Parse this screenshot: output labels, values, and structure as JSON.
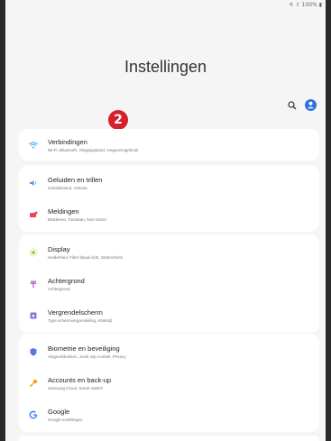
{
  "status": {
    "text": "⚟ ⇧ 100% ▮"
  },
  "header": {
    "title": "Instellingen"
  },
  "annotation": {
    "badge": "2"
  },
  "sections": [
    {
      "items": [
        {
          "label": "Verbindingen",
          "sub": "Wi-Fi, Bluetooth, Vliegtuigstand, Gegevensgebruik",
          "icon": "wifi-icon",
          "color": "#3aa0e8"
        }
      ]
    },
    {
      "items": [
        {
          "label": "Geluiden en trillen",
          "sub": "Geluidsstand, Volume",
          "icon": "volume-icon",
          "color": "#5b8fe8"
        },
        {
          "label": "Meldingen",
          "sub": "Blokkeren, Toestaan, Niet storen",
          "icon": "notification-icon",
          "color": "#e8455a"
        }
      ]
    },
    {
      "items": [
        {
          "label": "Display",
          "sub": "Helderheid, Filter blauw licht, Startscherm",
          "icon": "sun-icon",
          "color": "#9bd23a"
        },
        {
          "label": "Achtergrond",
          "sub": "Achtergrond",
          "icon": "wallpaper-icon",
          "color": "#b56ad8"
        },
        {
          "label": "Vergrendelscherm",
          "sub": "Type schermvergrendeling, Klokstijl",
          "icon": "lock-icon",
          "color": "#8a6fe0"
        }
      ]
    },
    {
      "items": [
        {
          "label": "Biometrie en beveiliging",
          "sub": "Vingerafdrukken, Zoek mijn mobiel, Privacy",
          "icon": "shield-icon",
          "color": "#5a73e8"
        },
        {
          "label": "Accounts en back-up",
          "sub": "Samsung Cloud, Smart Switch",
          "icon": "key-icon",
          "color": "#f3a41d"
        },
        {
          "label": "Google",
          "sub": "Google-instellingen",
          "icon": "google-icon",
          "color": "#4285f4"
        }
      ]
    }
  ]
}
